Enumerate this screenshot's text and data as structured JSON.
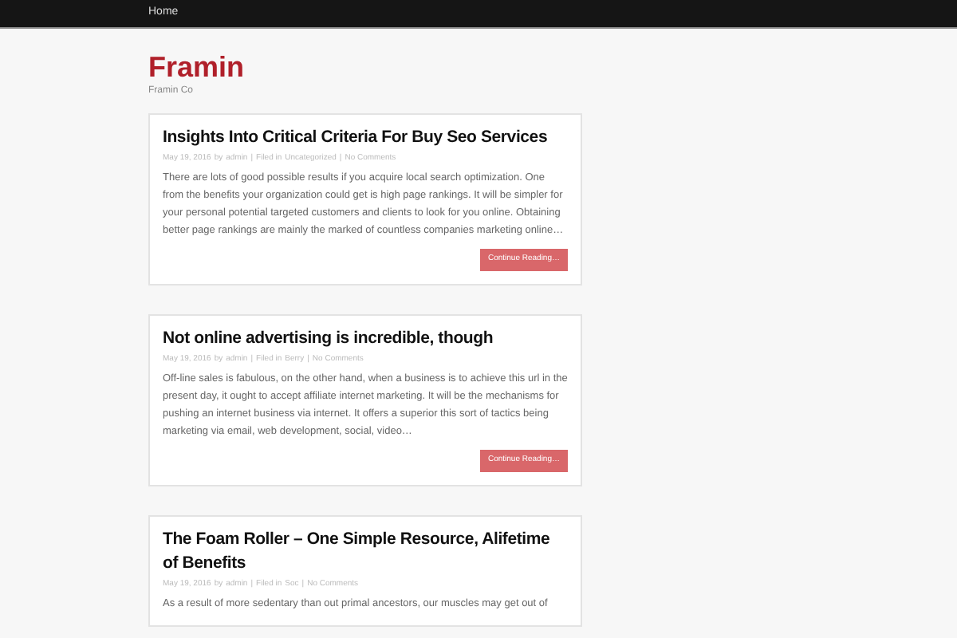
{
  "nav": {
    "items": [
      {
        "label": "Home"
      }
    ]
  },
  "site": {
    "title": "Framin",
    "tagline": "Framin Co"
  },
  "posts": [
    {
      "title": "Insights Into Critical Criteria For Buy Seo Services",
      "date": "May 19, 2016",
      "by": "by",
      "author": "admin",
      "filed": "Filed in",
      "category": "Uncategorized",
      "sep": "|",
      "comments": "No Comments",
      "excerpt": "There are lots of good possible results if you acquire local search optimization. One from the benefits your organization could get is high page rankings. It will be simpler for your personal potential targeted customers and clients to look for you online. Obtaining better page rankings are mainly the marked of countless companies marketing online…",
      "button": "Continue Reading…"
    },
    {
      "title": "Not online advertising is incredible, though",
      "date": "May 19, 2016",
      "by": "by",
      "author": "admin",
      "filed": "Filed in",
      "category": "Berry",
      "sep": "|",
      "comments": "No Comments",
      "excerpt": "Off-line sales is fabulous, on the other hand, when a business is to achieve this url in the present day, it ought to accept affiliate internet marketing. It will be the mechanisms for pushing an internet business via internet. It offers a superior this sort of tactics being marketing via email, web development, social, video…",
      "button": "Continue Reading…"
    },
    {
      "title": "The Foam Roller – One Simple Resource, Alifetime of Benefits",
      "date": "May 19, 2016",
      "by": "by",
      "author": "admin",
      "filed": "Filed in",
      "category": "Soc",
      "sep": "|",
      "comments": "No Comments",
      "excerpt": "As a result of more sedentary than out primal ancestors, our muscles may get out of"
    }
  ]
}
